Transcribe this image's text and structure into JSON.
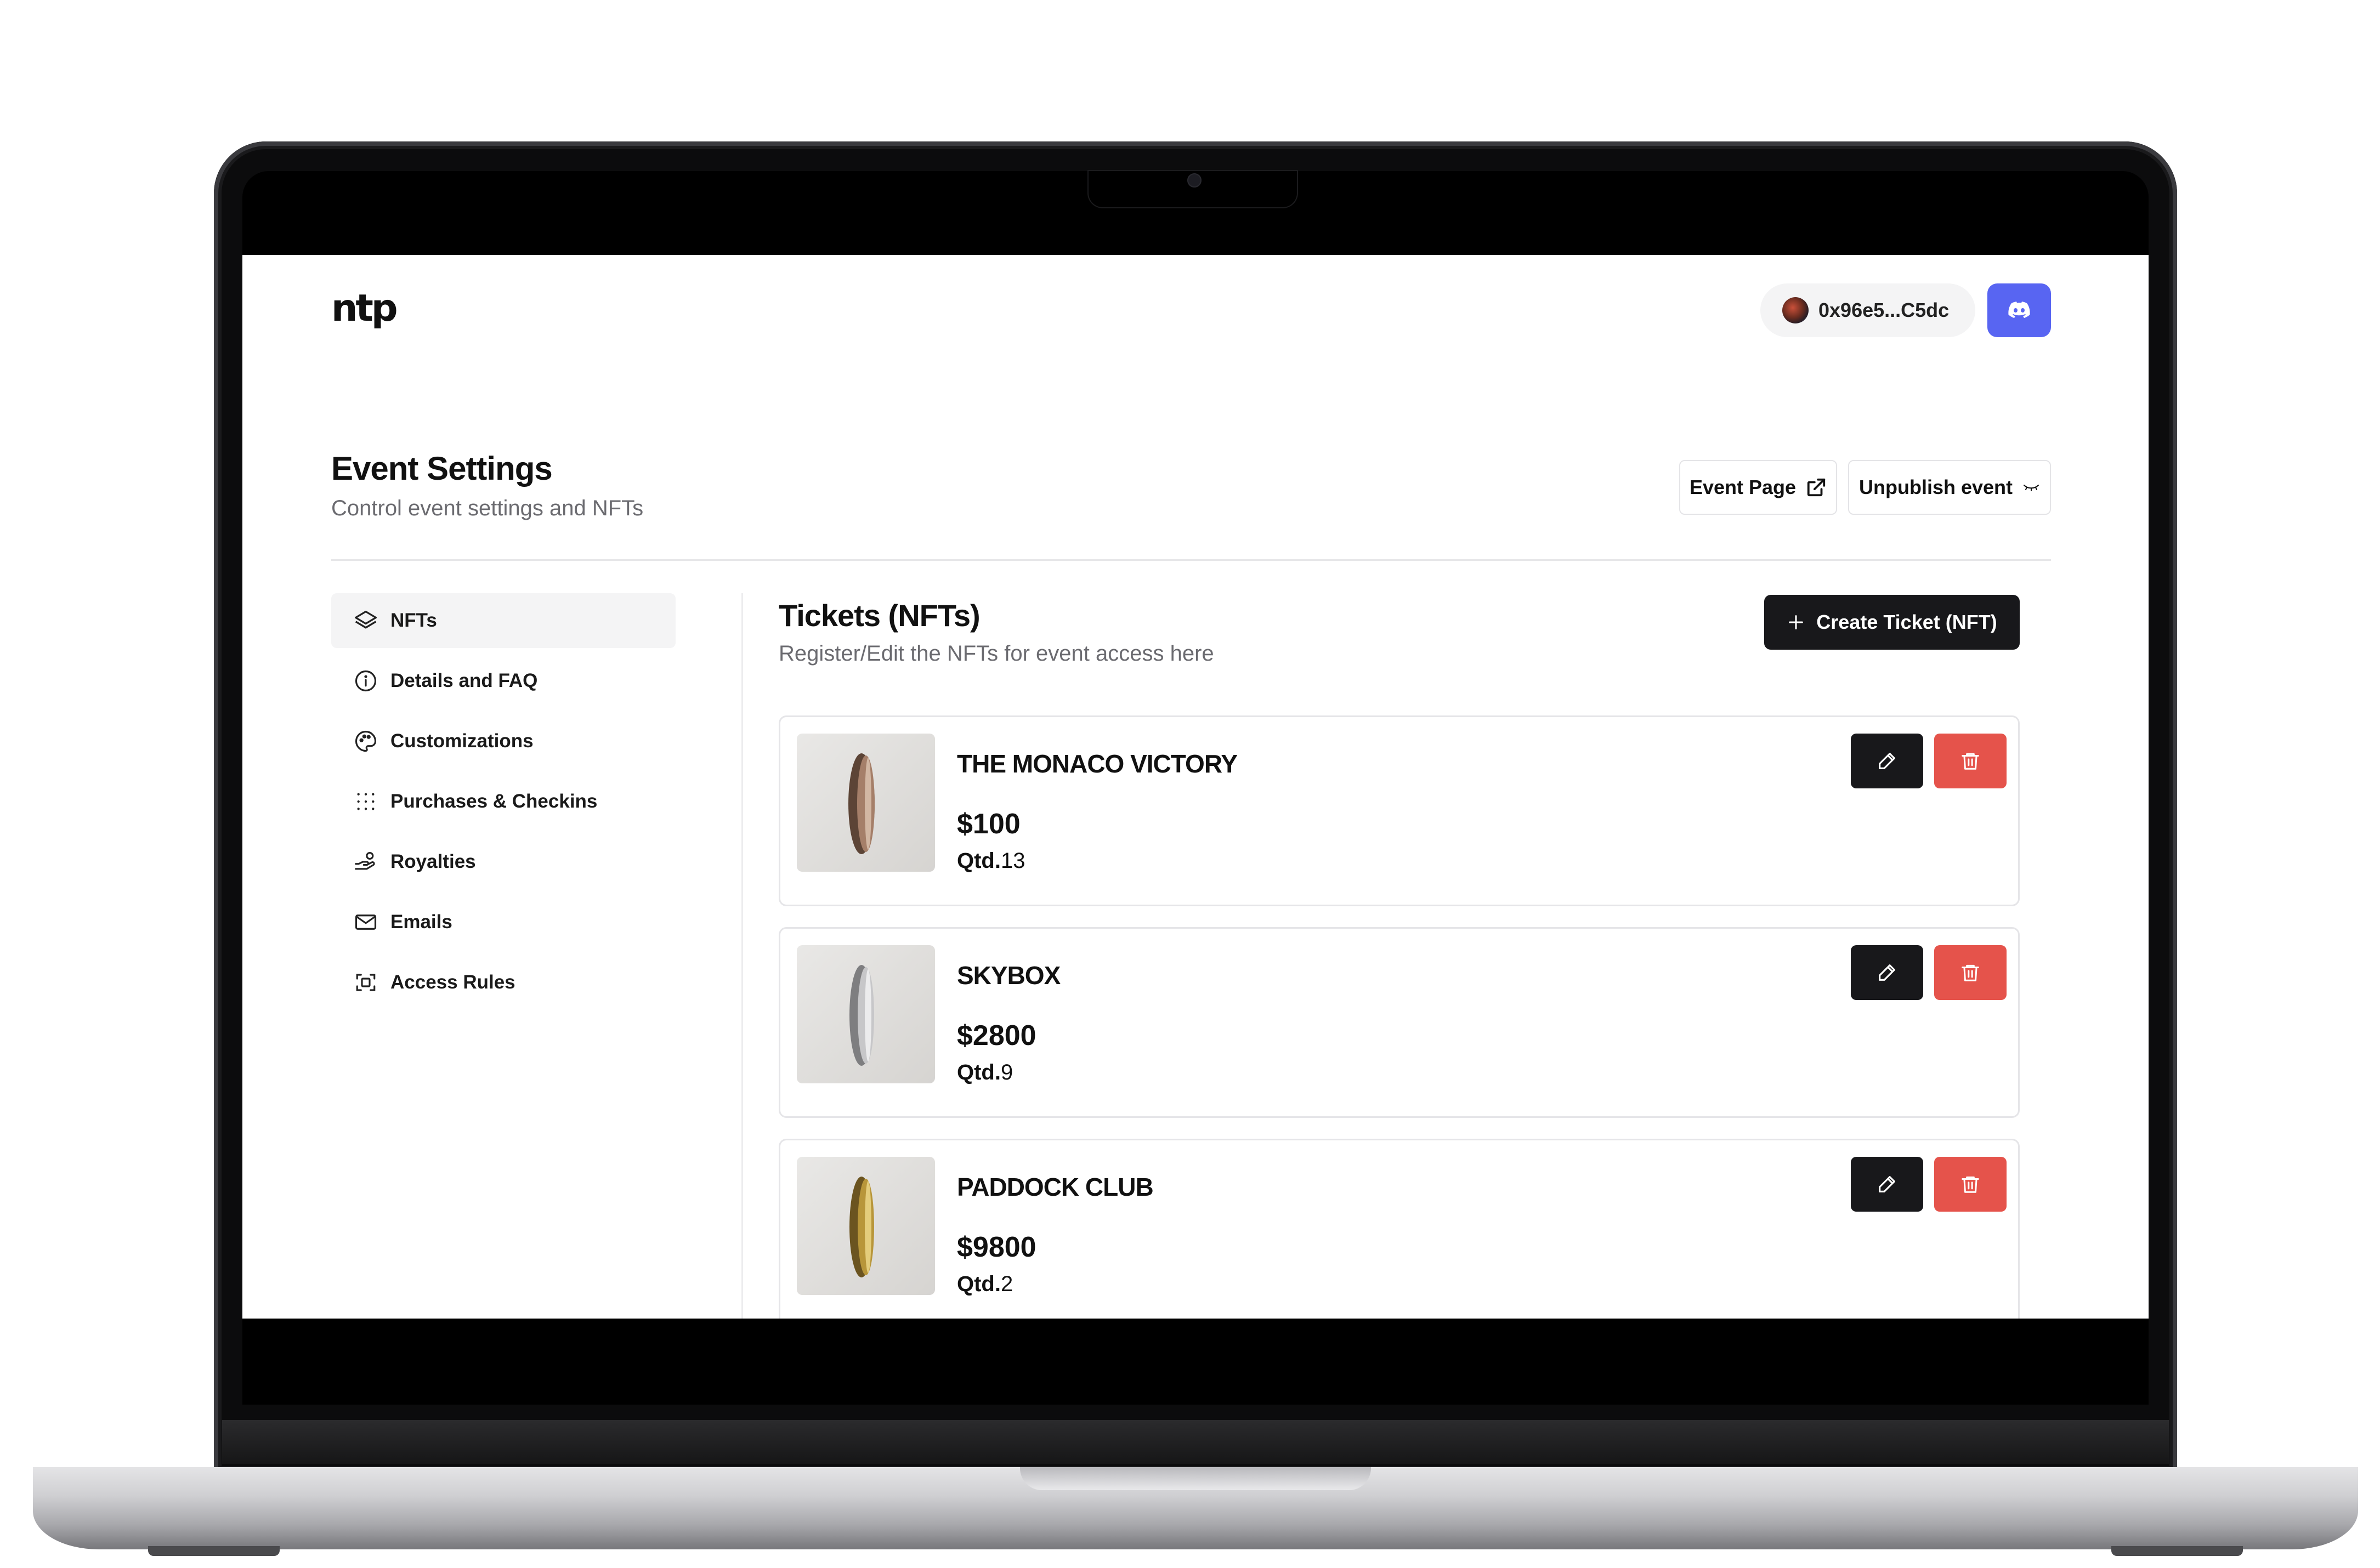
{
  "app": {
    "logo_text": "ntp",
    "wallet_address": "0x96e5...C5dc",
    "discord_label": "Discord"
  },
  "header": {
    "title": "Event Settings",
    "subtitle": "Control event settings and NFTs",
    "event_page_label": "Event Page",
    "unpublish_label": "Unpublish event"
  },
  "sidebar": {
    "items": [
      {
        "label": "NFTs",
        "icon": "layers-icon",
        "active": true
      },
      {
        "label": "Details and FAQ",
        "icon": "info-icon",
        "active": false
      },
      {
        "label": "Customizations",
        "icon": "palette-icon",
        "active": false
      },
      {
        "label": "Purchases & Checkins",
        "icon": "dots-grid-icon",
        "active": false
      },
      {
        "label": "Royalties",
        "icon": "hand-coins-icon",
        "active": false
      },
      {
        "label": "Emails",
        "icon": "mail-icon",
        "active": false
      },
      {
        "label": "Access Rules",
        "icon": "scan-icon",
        "active": false
      }
    ]
  },
  "main": {
    "title": "Tickets (NFTs)",
    "subtitle": "Register/Edit the NFTs for event access here",
    "create_label": "Create Ticket (NFT)",
    "qtd_prefix": "Qtd.",
    "tickets": [
      {
        "name": "THE MONACO VICTORY",
        "price": "$100",
        "qtd": "13",
        "coin_color": "#8a6a58"
      },
      {
        "name": "SKYBOX",
        "price": "$2800",
        "qtd": "9",
        "coin_color": "#a9a9ab"
      },
      {
        "name": "PADDOCK CLUB",
        "price": "$9800",
        "qtd": "2",
        "coin_color": "#b8963a"
      }
    ]
  },
  "colors": {
    "discord": "#5865f2",
    "delete": "#e5534b",
    "primary": "#18181b"
  }
}
